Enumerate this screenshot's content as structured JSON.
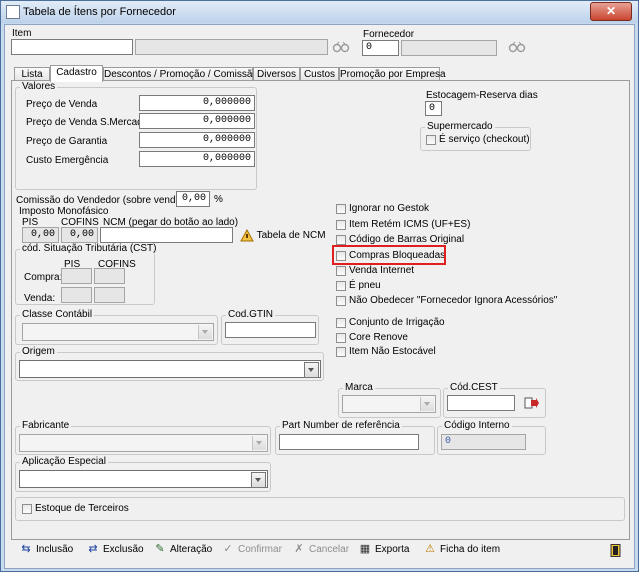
{
  "window": {
    "title": "Tabela de Ítens por Fornecedor",
    "close_glyph": "✕"
  },
  "header": {
    "item_label": "Item",
    "fornecedor_label": "Fornecedor",
    "fornecedor_code": "0"
  },
  "tabs": [
    "Lista",
    "Cadastro",
    "Descontos / Promoção / Comissão",
    "Diversos",
    "Custos",
    "Promoção por Empresa"
  ],
  "valores": {
    "title": "Valores",
    "rows": [
      {
        "label": "Preço de Venda",
        "value": "0,000000"
      },
      {
        "label": "Preço de Venda S.Mercado",
        "value": "0,000000"
      },
      {
        "label": "Preço de Garantia",
        "value": "0,000000"
      },
      {
        "label": "Custo Emergência",
        "value": "0,000000"
      }
    ]
  },
  "estocagem": {
    "label": "Estocagem-Reserva dias",
    "value": "0"
  },
  "supermercado": {
    "title": "Supermercado",
    "checkbox": "É serviço (checkout)"
  },
  "comissao": {
    "label": "Comissão do Vendedor (sobre venda)",
    "value": "0,00",
    "unit": "%"
  },
  "imposto": {
    "title": "Imposto Monofásico",
    "pis_label": "PIS",
    "cofins_label": "COFINS",
    "ncm_label": "NCM (pegar do botão ao lado)",
    "pis_value": "0,00",
    "cofins_value": "0,00",
    "ncm_button": "Tabela de NCM"
  },
  "cst": {
    "title": "cód. Situação Tributária (CST)",
    "pis_label": "PIS",
    "cofins_label": "COFINS",
    "compra_label": "Compra:",
    "venda_label": "Venda:"
  },
  "checkboxes_a": [
    "Ignorar no Gestok",
    "Item Retém ICMS (UF+ES)",
    "Código de Barras Original",
    "Compras Bloqueadas",
    "Venda Internet",
    "É pneu",
    "Não Obedecer \"Fornecedor Ignora Acessórios\""
  ],
  "checkboxes_b": [
    "Conjunto de Irrigação",
    "Core Renove",
    "Item Não Estocável"
  ],
  "classe_contabil": {
    "label": "Classe Contábil"
  },
  "cod_gtin": {
    "label": "Cod.GTIN"
  },
  "origem": {
    "label": "Origem"
  },
  "marca": {
    "label": "Marca"
  },
  "cod_cest": {
    "label": "Cód.CEST"
  },
  "fabricante": {
    "label": "Fabricante"
  },
  "part_number": {
    "label": "Part Number de referência"
  },
  "codigo_interno": {
    "label": "Código Interno",
    "value": "0"
  },
  "aplicacao": {
    "label": "Aplicação Especial"
  },
  "estoque_terceiros": {
    "label": "Estoque de Terceiros"
  },
  "toolbar": {
    "inclusao": "Inclusão",
    "exclusao": "Exclusão",
    "alteracao": "Alteração",
    "confirmar": "Confirmar",
    "cancelar": "Cancelar",
    "exporta": "Exporta",
    "ficha": "Ficha do item"
  }
}
